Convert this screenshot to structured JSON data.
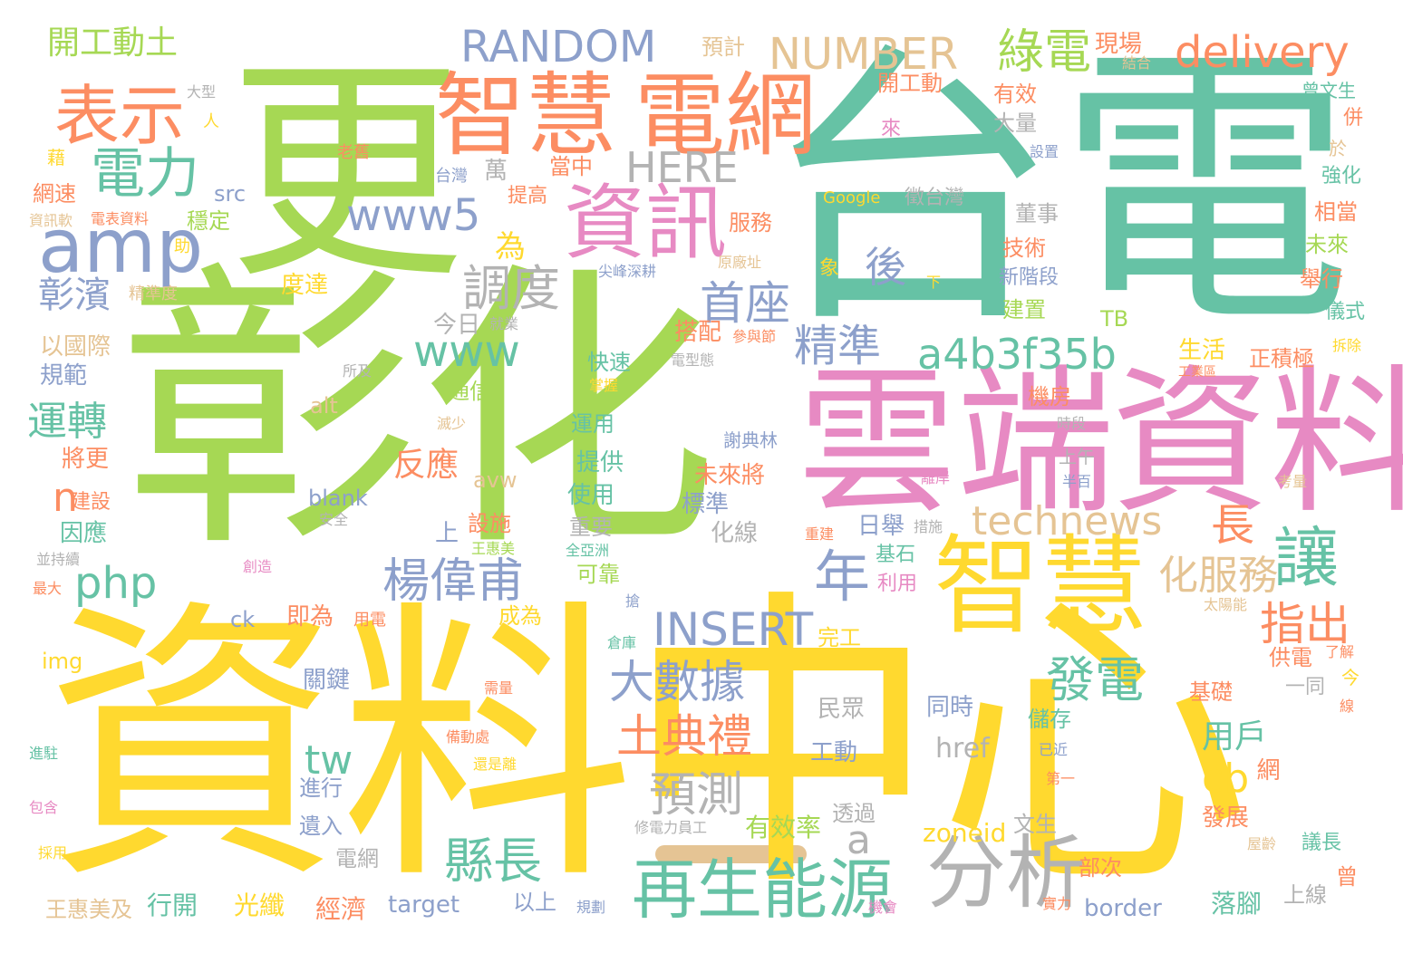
{
  "palette": {
    "teal": "#66c2a5",
    "orange": "#fc8d62",
    "blue": "#8da0cb",
    "pink": "#e78ac3",
    "green": "#a6d854",
    "yellow": "#ffd92f",
    "tan": "#e5c494",
    "gray": "#b3b3b3"
  },
  "words": {
    "w001": "更",
    "w002": "彰化",
    "w003": "台電",
    "w004": "資料",
    "w005": "中心",
    "w006": "雲端",
    "w007": "資料",
    "w008": "智慧",
    "w009": "電網",
    "w010": "智慧",
    "w011": "資訊",
    "w012": "表示",
    "w013": "分析",
    "w014": "再生能源",
    "w015": "amp",
    "w016": "電力",
    "w017": "RANDOM",
    "w018": "NUMBER",
    "w019": "綠電",
    "w020": "delivery",
    "w021": "HERE",
    "w022": "www5",
    "w023": "後",
    "w024": "讓",
    "w025": "首座",
    "w026": "精準",
    "w027": "a4b3f35b",
    "w028": "調度",
    "w029": "www",
    "w030": "technews",
    "w031": "楊偉甫",
    "w032": "年",
    "w033": "化服務",
    "w034": "INSERT",
    "w035": "大數據",
    "w036": "指出",
    "w037": "發電",
    "w038": "土典禮",
    "w039": "預測",
    "w040": "縣長",
    "w041": "php",
    "w042": "彰濱",
    "w043": "運轉",
    "w044": "長",
    "w045": "cb",
    "w046": "開工動土",
    "w047": "為",
    "w048": "tw",
    "w049": "反應",
    "w050": "n",
    "w051": "a",
    "w052": "用戶",
    "w053": "href",
    "w054": "zoneid",
    "w055": "有效率",
    "w056": "光纖",
    "w057": "border",
    "w058": "target",
    "w059": "落腳",
    "w060": "經濟",
    "w061": "行開",
    "w062": "王惠美及",
    "w063": "預計",
    "w064": "現場",
    "w065": "開工動",
    "w066": "有效",
    "w067": "大量",
    "w068": "萬",
    "w069": "當中",
    "w070": "服務",
    "w071": "度達",
    "w072": "今日",
    "w073": "以國際",
    "w074": "規範",
    "w075": "將更",
    "w076": "因應",
    "w077": "建設",
    "w078": "src",
    "w079": "網速",
    "w080": "穩定",
    "w081": "alt",
    "w082": "avw",
    "w083": "blank",
    "w084": "img",
    "w085": "ck",
    "w086": "即為",
    "w087": "上",
    "w088": "設施",
    "w089": "使用",
    "w090": "提供",
    "w091": "重要",
    "w092": "可靠",
    "w093": "成為",
    "w094": "通信",
    "w095": "快速",
    "w096": "運用",
    "w097": "搭配",
    "w098": "未來將",
    "w099": "標準",
    "w100": "化線",
    "w101": "日舉",
    "w102": "基石",
    "w103": "利用",
    "w104": "民眾",
    "w105": "同時",
    "w106": "工動",
    "w107": "進行",
    "w108": "遺入",
    "w109": "電網",
    "w110": "透過",
    "w111": "文生",
    "w112": "部次",
    "w113": "以上",
    "w114": "上線",
    "w115": "發展",
    "w116": "儲存",
    "w117": "機房",
    "w118": "生活",
    "w119": "正積極",
    "w120": "建置",
    "w121": "技術",
    "w122": "董事",
    "w123": "新階段",
    "w124": "TB",
    "w125": "上午",
    "w126": "基礎",
    "w127": "一同",
    "w128": "供電",
    "w129": "網",
    "w130": "完工",
    "w131": "關鍵",
    "w132": "提高",
    "w133": "台灣",
    "w134": "來",
    "w135": "徵台灣",
    "w136": "Google",
    "w137": "謝典林",
    "w138": "象",
    "w139": "下",
    "w140": "強化",
    "w141": "相當",
    "w142": "未來",
    "w143": "舉行",
    "w144": "儀式",
    "w145": "併",
    "w146": "於",
    "w147": "曾文生",
    "w148": "結合",
    "w149": "設置",
    "w150": "大型",
    "w151": "人",
    "w152": "老舊",
    "w153": "藉",
    "w154": "資訊軟",
    "w155": "電表資料",
    "w156": "助",
    "w157": "精準度",
    "w158": "所及",
    "w159": "就業",
    "w160": "尖峰深耕",
    "w161": "原廠址",
    "w162": "參與節",
    "w163": "電型態",
    "w164": "掌握",
    "w165": "滅少",
    "w166": "時段",
    "w167": "半百",
    "w168": "離岸",
    "w169": "安全",
    "w170": "並持續",
    "w171": "最大",
    "w172": "創造",
    "w173": "王惠美",
    "w174": "全亞洲",
    "w175": "重建",
    "w176": "措施",
    "w177": "太陽能",
    "w178": "搶",
    "w179": "用電",
    "w180": "倉庫",
    "w181": "了解",
    "w182": "需量",
    "w183": "備動處",
    "w184": "還是離",
    "w185": "進駐",
    "w186": "包含",
    "w187": "採用",
    "w188": "修電力員工",
    "w189": "規劃",
    "w190": "機會",
    "w191": "實力",
    "w192": "屋齡",
    "w193": "議長",
    "w194": "考量",
    "w195": "今",
    "w196": "線",
    "w197": "曾",
    "w198": "已近",
    "w199": "第一",
    "w200": "拆除",
    "w201": "工業區"
  }
}
